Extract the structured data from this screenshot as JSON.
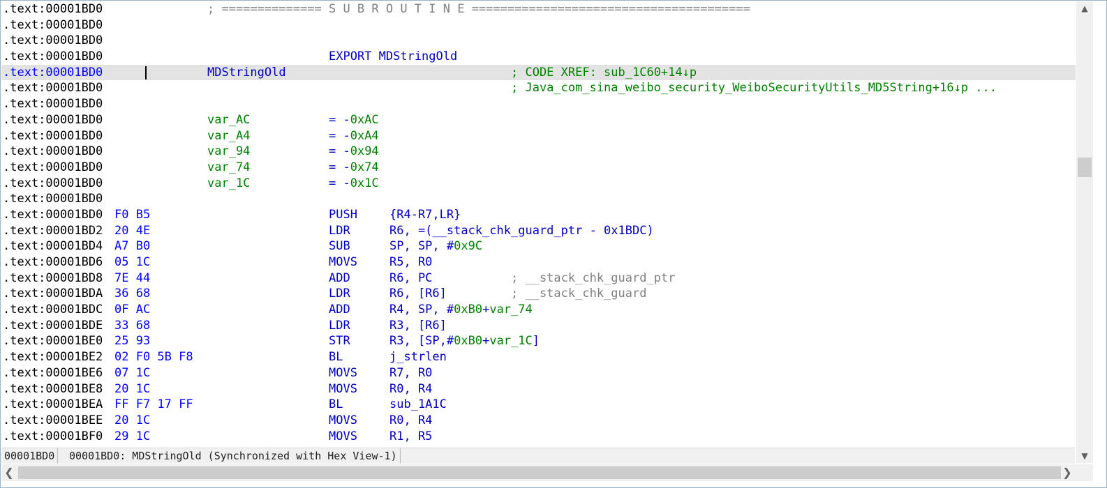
{
  "listing": {
    "rows": [
      {
        "addr": ".text:00001BD0",
        "sep": "; ============== S U B R O U T I N E ======================================="
      },
      {
        "addr": ".text:00001BD0"
      },
      {
        "addr": ".text:00001BD0"
      },
      {
        "addr": ".text:00001BD0",
        "mnem": "EXPORT MDStringOld"
      },
      {
        "addr": ".text:00001BD0",
        "label": "MDStringOld",
        "xref": "; CODE XREF: sub_1C60+14↓p",
        "selected": true
      },
      {
        "addr": ".text:00001BD0",
        "xref": "; Java_com_sina_weibo_security_WeiboSecurityUtils_MD5String+16↓p ..."
      },
      {
        "addr": ".text:00001BD0"
      },
      {
        "addr": ".text:00001BD0",
        "var": "var_AC",
        "eq": "= -",
        "val": "0xAC"
      },
      {
        "addr": ".text:00001BD0",
        "var": "var_A4",
        "eq": "= -",
        "val": "0xA4"
      },
      {
        "addr": ".text:00001BD0",
        "var": "var_94",
        "eq": "= -",
        "val": "0x94"
      },
      {
        "addr": ".text:00001BD0",
        "var": "var_74",
        "eq": "= -",
        "val": "0x74"
      },
      {
        "addr": ".text:00001BD0",
        "var": "var_1C",
        "eq": "= -",
        "val": "0x1C"
      },
      {
        "addr": ".text:00001BD0"
      },
      {
        "addr": ".text:00001BD0",
        "bytes": "F0 B5",
        "mnem": "PUSH",
        "ops": [
          {
            "t": "{R4-R7,LR}"
          }
        ]
      },
      {
        "addr": ".text:00001BD2",
        "bytes": "20 4E",
        "mnem": "LDR",
        "ops": [
          {
            "t": "R6, =(__stack_chk_guard_ptr - 0x1BDC)"
          }
        ]
      },
      {
        "addr": ".text:00001BD4",
        "bytes": "A7 B0",
        "mnem": "SUB",
        "ops": [
          {
            "t": "SP, SP, #"
          },
          {
            "t": "0x9C",
            "g": true
          }
        ]
      },
      {
        "addr": ".text:00001BD6",
        "bytes": "05 1C",
        "mnem": "MOVS",
        "ops": [
          {
            "t": "R5, R0"
          }
        ]
      },
      {
        "addr": ".text:00001BD8",
        "bytes": "7E 44",
        "mnem": "ADD",
        "ops": [
          {
            "t": "R6, PC"
          }
        ],
        "cmt": "; __stack_chk_guard_ptr"
      },
      {
        "addr": ".text:00001BDA",
        "bytes": "36 68",
        "mnem": "LDR",
        "ops": [
          {
            "t": "R6, [R6]"
          }
        ],
        "cmt": "; __stack_chk_guard"
      },
      {
        "addr": ".text:00001BDC",
        "bytes": "0F AC",
        "mnem": "ADD",
        "ops": [
          {
            "t": "R4, SP, #"
          },
          {
            "t": "0xB0",
            "g": true
          },
          {
            "t": "+"
          },
          {
            "t": "var_74",
            "g": true
          }
        ]
      },
      {
        "addr": ".text:00001BDE",
        "bytes": "33 68",
        "mnem": "LDR",
        "ops": [
          {
            "t": "R3, [R6]"
          }
        ]
      },
      {
        "addr": ".text:00001BE0",
        "bytes": "25 93",
        "mnem": "STR",
        "ops": [
          {
            "t": "R3, [SP,#"
          },
          {
            "t": "0xB0",
            "g": true
          },
          {
            "t": "+"
          },
          {
            "t": "var_1C",
            "g": true
          },
          {
            "t": "]"
          }
        ]
      },
      {
        "addr": ".text:00001BE2",
        "bytes": "02 F0 5B F8",
        "mnem": "BL",
        "ops": [
          {
            "t": "j_strlen"
          }
        ]
      },
      {
        "addr": ".text:00001BE6",
        "bytes": "07 1C",
        "mnem": "MOVS",
        "ops": [
          {
            "t": "R7, R0"
          }
        ]
      },
      {
        "addr": ".text:00001BE8",
        "bytes": "20 1C",
        "mnem": "MOVS",
        "ops": [
          {
            "t": "R0, R4"
          }
        ]
      },
      {
        "addr": ".text:00001BEA",
        "bytes": "FF F7 17 FF",
        "mnem": "BL",
        "ops": [
          {
            "t": "sub_1A1C"
          }
        ]
      },
      {
        "addr": ".text:00001BEE",
        "bytes": "20 1C",
        "mnem": "MOVS",
        "ops": [
          {
            "t": "R0, R4"
          }
        ]
      },
      {
        "addr": ".text:00001BF0",
        "bytes": "29 1C",
        "mnem": "MOVS",
        "ops": [
          {
            "t": "R1, R5"
          }
        ]
      }
    ]
  },
  "statusbar": {
    "address": "00001BD0",
    "location": "00001BD0: MDStringOld (Synchronized with Hex View-1)"
  },
  "scrollbar": {
    "up_arrow": "▲",
    "down_arrow": "▼",
    "left_arrow": "❮",
    "right_arrow": "❯"
  }
}
